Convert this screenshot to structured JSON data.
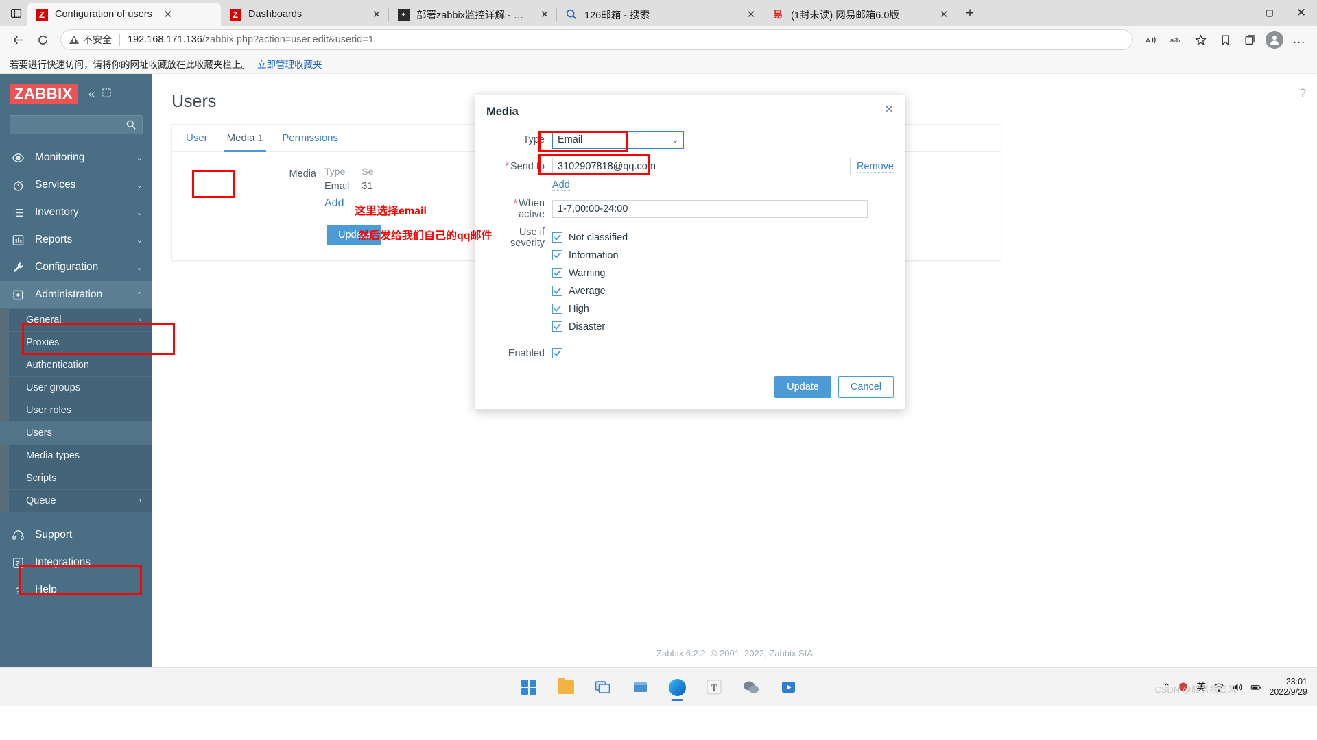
{
  "browser": {
    "tabs": [
      {
        "title": "Configuration of users",
        "favicon": "zabbix-icon",
        "active": true
      },
      {
        "title": "Dashboards",
        "favicon": "zabbix-icon",
        "active": false
      },
      {
        "title": "部署zabbix监控详解 - 玄凌道人",
        "favicon": "dark-site-icon",
        "active": false
      },
      {
        "title": "126邮箱 - 搜索",
        "favicon": "search-icon",
        "active": false
      },
      {
        "title": "(1封未读) 网易邮箱6.0版",
        "favicon": "netease-icon",
        "active": false
      }
    ],
    "new_tab_label": "+",
    "window_controls": {
      "minimize": "—",
      "maximize": "▢",
      "close": "✕"
    },
    "toolbar": {
      "back": "←",
      "reload": "⟳",
      "security_label": "不安全",
      "url_host": "192.168.171.136",
      "url_path": "/zabbix.php?action=user.edit&userid=1",
      "read_aloud": "A",
      "translate": "aあ",
      "favorite_add": "☆",
      "favorites": "favorites",
      "collections": "collections",
      "profile": "profile",
      "settings_more": "…"
    },
    "bookmark_bar": {
      "message": "若要进行快速访问，请将你的网址收藏放在此收藏夹栏上。",
      "link": "立即管理收藏夹"
    }
  },
  "sidebar": {
    "logo": "ZABBIX",
    "collapse_icon": "«",
    "expand_icon": "expand-icon",
    "search_placeholder": "",
    "items": [
      {
        "label": "Monitoring",
        "icon": "eye-icon",
        "arrow": "⌄"
      },
      {
        "label": "Services",
        "icon": "stopwatch-icon",
        "arrow": "⌄"
      },
      {
        "label": "Inventory",
        "icon": "list-icon",
        "arrow": "⌄"
      },
      {
        "label": "Reports",
        "icon": "bar-chart-icon",
        "arrow": "⌄"
      },
      {
        "label": "Configuration",
        "icon": "wrench-icon",
        "arrow": "⌄"
      },
      {
        "label": "Administration",
        "icon": "puzzle-icon",
        "arrow": "⌃",
        "expanded": true
      }
    ],
    "administration_subitems": [
      {
        "label": "General",
        "arrow": "›"
      },
      {
        "label": "Proxies",
        "arrow": ""
      },
      {
        "label": "Authentication",
        "arrow": ""
      },
      {
        "label": "User groups",
        "arrow": ""
      },
      {
        "label": "User roles",
        "arrow": ""
      },
      {
        "label": "Users",
        "arrow": "",
        "current": true
      },
      {
        "label": "Media types",
        "arrow": ""
      },
      {
        "label": "Scripts",
        "arrow": ""
      },
      {
        "label": "Queue",
        "arrow": "›"
      }
    ],
    "bottom_items": [
      {
        "label": "Support",
        "icon": "headset-icon"
      },
      {
        "label": "Integrations",
        "icon": "zabbix-z-icon"
      },
      {
        "label": "Help",
        "icon": "question-icon"
      }
    ]
  },
  "page": {
    "title": "Users",
    "help_icon": "?",
    "tabs": [
      {
        "label": "User",
        "active": false
      },
      {
        "label": "Media",
        "count": "1",
        "active": true
      },
      {
        "label": "Permissions",
        "active": false
      }
    ],
    "media_form": {
      "label": "Media",
      "columns": [
        "Type",
        "Se"
      ],
      "rows": [
        [
          "Email",
          "31"
        ]
      ],
      "add_link": "Add",
      "update_button": "Update"
    },
    "footer": "Zabbix 6.2.2. © 2001–2022, Zabbix SIA",
    "footer_brand": "Zabbix SIA"
  },
  "modal": {
    "title": "Media",
    "close_icon": "✕",
    "fields": {
      "type_label": "Type",
      "type_value": "Email",
      "type_chevron": "⌄",
      "send_to_label": "Send to",
      "send_to_required": "*",
      "send_to_value": "3102907818@qq.com",
      "remove_link": "Remove",
      "add_link": "Add",
      "when_active_label": "When active",
      "when_active_required": "*",
      "when_active_value": "1-7,00:00-24:00",
      "severity_label": "Use if severity",
      "enabled_label": "Enabled"
    },
    "severities": [
      {
        "label": "Not classified",
        "checked": true
      },
      {
        "label": "Information",
        "checked": true
      },
      {
        "label": "Warning",
        "checked": true
      },
      {
        "label": "Average",
        "checked": true
      },
      {
        "label": "High",
        "checked": true
      },
      {
        "label": "Disaster",
        "checked": true
      }
    ],
    "enabled_checked": true,
    "buttons": {
      "update": "Update",
      "cancel": "Cancel"
    }
  },
  "annotations": [
    {
      "text": "这里选择email",
      "color": "#ff0000"
    },
    {
      "text": "然后发给我们自己的qq邮件",
      "color": "#ff0000"
    }
  ],
  "taskbar": {
    "apps": [
      {
        "name": "start-button",
        "icon": "windows-logo"
      },
      {
        "name": "file-explorer",
        "icon": "folder-icon"
      },
      {
        "name": "task-view",
        "icon": "taskview-icon"
      },
      {
        "name": "store-app",
        "icon": "store-icon"
      },
      {
        "name": "edge-browser",
        "icon": "edge-icon",
        "active": true
      },
      {
        "name": "text-app",
        "icon": "text-icon"
      },
      {
        "name": "wechat-app",
        "icon": "wechat-icon"
      },
      {
        "name": "media-player",
        "icon": "media-icon"
      }
    ],
    "tray": {
      "chevron": "⌃",
      "security_icon": "security-icon",
      "ime": "英",
      "wifi_icon": "wifi-icon",
      "volume_icon": "volume-icon",
      "battery_icon": "battery-icon",
      "time": "23:01",
      "date": "2022/9/29"
    },
    "watermark": "CSDN @服务器云风"
  }
}
